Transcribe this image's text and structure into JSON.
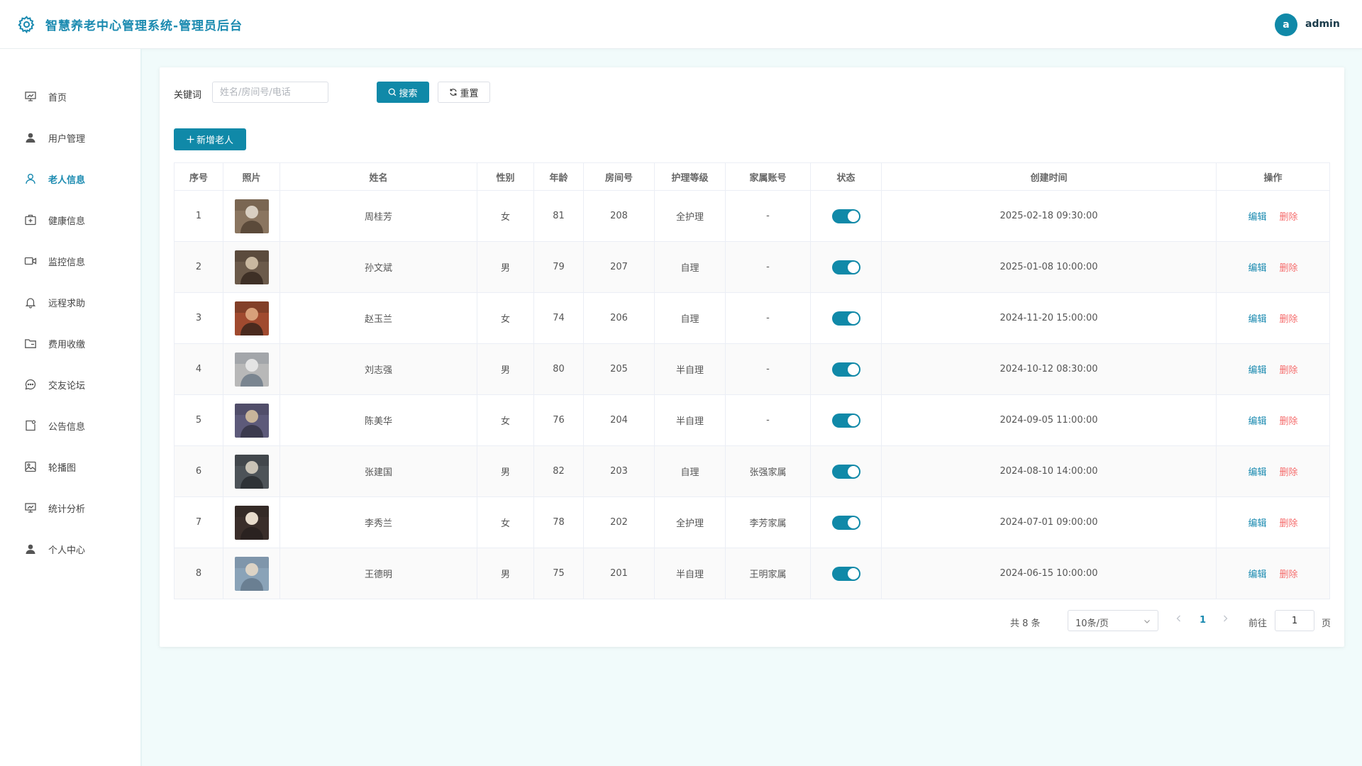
{
  "header": {
    "title": "智慧养老中心管理系统-管理员后台",
    "user_initial": "a",
    "username": "admin"
  },
  "sidebar": {
    "items": [
      {
        "label": "首页",
        "icon": "dashboard-icon"
      },
      {
        "label": "用户管理",
        "icon": "user-icon"
      },
      {
        "label": "老人信息",
        "icon": "person-outline-icon",
        "active": true
      },
      {
        "label": "健康信息",
        "icon": "first-aid-icon"
      },
      {
        "label": "监控信息",
        "icon": "video-camera-icon"
      },
      {
        "label": "远程求助",
        "icon": "bell-icon"
      },
      {
        "label": "费用收缴",
        "icon": "folder-icon"
      },
      {
        "label": "交友论坛",
        "icon": "chat-bubble-icon"
      },
      {
        "label": "公告信息",
        "icon": "notice-icon"
      },
      {
        "label": "轮播图",
        "icon": "image-icon"
      },
      {
        "label": "统计分析",
        "icon": "chart-board-icon"
      },
      {
        "label": "个人中心",
        "icon": "user-icon"
      }
    ]
  },
  "search": {
    "label": "关键词",
    "placeholder": "姓名/房间号/电话",
    "value": "",
    "search_button": "搜索",
    "reset_button": "重置"
  },
  "add_button": "新增老人",
  "table": {
    "columns": [
      "序号",
      "照片",
      "姓名",
      "性别",
      "年龄",
      "房间号",
      "护理等级",
      "家属账号",
      "状态",
      "创建时间",
      "操作"
    ],
    "edit_label": "编辑",
    "delete_label": "删除",
    "rows": [
      {
        "index": "1",
        "name": "周桂芳",
        "gender": "女",
        "age": "81",
        "room": "208",
        "care": "全护理",
        "family": "-",
        "status": true,
        "created": "2025-02-18 09:30:00"
      },
      {
        "index": "2",
        "name": "孙文斌",
        "gender": "男",
        "age": "79",
        "room": "207",
        "care": "自理",
        "family": "-",
        "status": true,
        "created": "2025-01-08 10:00:00"
      },
      {
        "index": "3",
        "name": "赵玉兰",
        "gender": "女",
        "age": "74",
        "room": "206",
        "care": "自理",
        "family": "-",
        "status": true,
        "created": "2024-11-20 15:00:00"
      },
      {
        "index": "4",
        "name": "刘志强",
        "gender": "男",
        "age": "80",
        "room": "205",
        "care": "半自理",
        "family": "-",
        "status": true,
        "created": "2024-10-12 08:30:00"
      },
      {
        "index": "5",
        "name": "陈美华",
        "gender": "女",
        "age": "76",
        "room": "204",
        "care": "半自理",
        "family": "-",
        "status": true,
        "created": "2024-09-05 11:00:00"
      },
      {
        "index": "6",
        "name": "张建国",
        "gender": "男",
        "age": "82",
        "room": "203",
        "care": "自理",
        "family": "张强家属",
        "status": true,
        "created": "2024-08-10 14:00:00"
      },
      {
        "index": "7",
        "name": "李秀兰",
        "gender": "女",
        "age": "78",
        "room": "202",
        "care": "全护理",
        "family": "李芳家属",
        "status": true,
        "created": "2024-07-01 09:00:00"
      },
      {
        "index": "8",
        "name": "王德明",
        "gender": "男",
        "age": "75",
        "room": "201",
        "care": "半自理",
        "family": "王明家属",
        "status": true,
        "created": "2024-06-15 10:00:00"
      }
    ]
  },
  "pagination": {
    "total": "共 8 条",
    "page_size": "10条/页",
    "current_page": "1",
    "goto_label": "前往",
    "goto_value": "1",
    "page_suffix": "页"
  },
  "colors": {
    "accent": "#1089a8",
    "title": "#1a8ab0",
    "danger": "#f56c6c",
    "background": "#f1fbfb"
  }
}
